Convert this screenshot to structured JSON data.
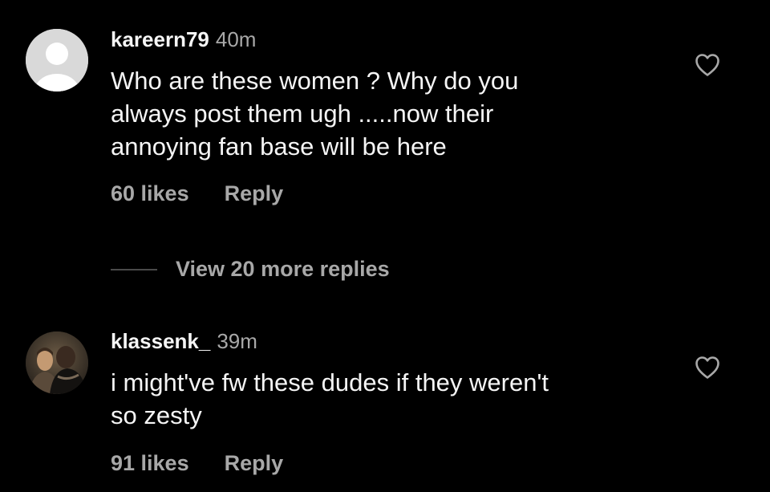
{
  "comments": [
    {
      "username": "kareern79",
      "timestamp": "40m",
      "text_lines": [
        "Who are these women ? Why do you",
        "always post them ugh .....now their",
        "annoying fan base will be here"
      ],
      "likes": "60 likes",
      "reply_label": "Reply",
      "avatar": "default-avatar-icon",
      "liked": false
    },
    {
      "username": "klassenk_",
      "timestamp": "39m",
      "text_lines": [
        "i might've fw these dudes if they weren't",
        "so zesty"
      ],
      "likes": "91 likes",
      "reply_label": "Reply",
      "avatar": "photo-avatar",
      "liked": false
    }
  ],
  "view_replies": {
    "label": "View 20 more replies"
  },
  "colors": {
    "background": "#000000",
    "primary_text": "#f5f5f5",
    "secondary_text": "#a8a8a8",
    "divider": "#4a4a4a"
  }
}
